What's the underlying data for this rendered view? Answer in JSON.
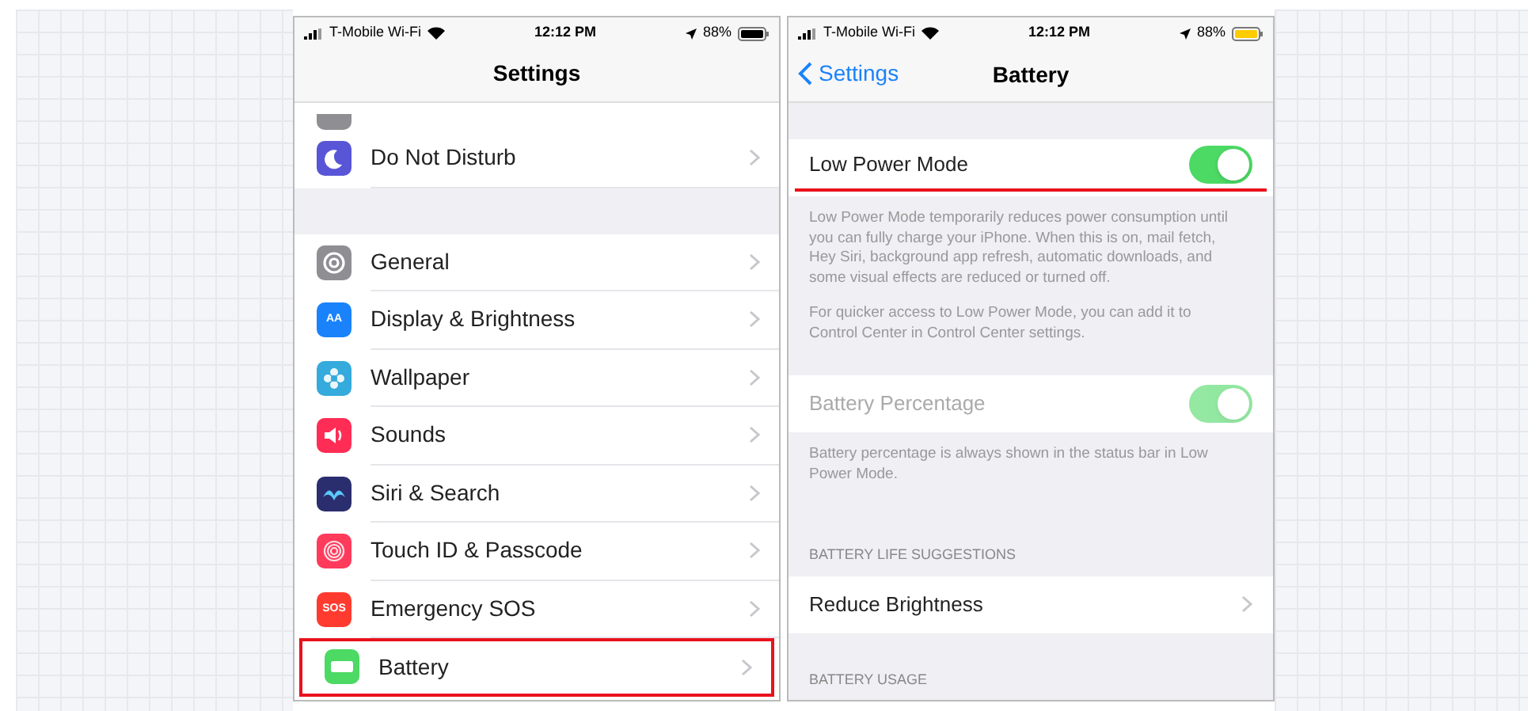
{
  "settings_screen": {
    "status_bar": {
      "carrier": "T-Mobile Wi-Fi",
      "time": "12:12 PM",
      "battery_percent": "88%",
      "low_power": false
    },
    "title": "Settings",
    "groups": [
      [
        {
          "kind": "moon",
          "color": "#5856d6",
          "label": "Do Not Disturb",
          "highlighted": false
        }
      ],
      [
        {
          "kind": "gear",
          "color": "#8e8e93",
          "label": "General",
          "highlighted": false
        },
        {
          "kind": "letters",
          "color": "#1a82fb",
          "label": "Display & Brightness",
          "highlighted": false,
          "glyph": "AA"
        },
        {
          "kind": "flower",
          "color": "#35aadc",
          "label": "Wallpaper",
          "highlighted": false
        },
        {
          "kind": "speaker",
          "color": "#ff2d55",
          "label": "Sounds",
          "highlighted": false
        },
        {
          "kind": "siri",
          "color": "#2b2e6e",
          "label": "Siri & Search",
          "highlighted": false
        },
        {
          "kind": "fingerprint",
          "color": "#ff3b5c",
          "label": "Touch ID & Passcode",
          "highlighted": false
        },
        {
          "kind": "letters",
          "color": "#ff3b30",
          "label": "Emergency SOS",
          "highlighted": false,
          "glyph": "SOS"
        },
        {
          "kind": "battery",
          "color": "#4cd964",
          "label": "Battery",
          "highlighted": true
        }
      ]
    ]
  },
  "battery_screen": {
    "status_bar": {
      "carrier": "T-Mobile Wi-Fi",
      "time": "12:12 PM",
      "battery_percent": "88%",
      "low_power": true
    },
    "back": "Settings",
    "title": "Battery",
    "sections": [
      {
        "kind": "toggle",
        "label": "Low Power Mode",
        "on": true,
        "disabled": false,
        "highlighted": true,
        "footer": [
          "Low Power Mode temporarily reduces power consumption until you can fully charge your iPhone. When this is on, mail fetch, Hey Siri, background app refresh, automatic downloads, and some visual effects are reduced or turned off.",
          "For quicker access to Low Power Mode, you can add it to Control Center in Control Center settings."
        ]
      },
      {
        "kind": "toggle",
        "label": "Battery Percentage",
        "on": true,
        "disabled": true,
        "footer": [
          "Battery percentage is always shown in the status bar in Low Power Mode."
        ]
      },
      {
        "kind": "link",
        "header": "BATTERY LIFE SUGGESTIONS",
        "label": "Reduce Brightness"
      },
      {
        "kind": "header",
        "header": "BATTERY USAGE"
      }
    ]
  }
}
